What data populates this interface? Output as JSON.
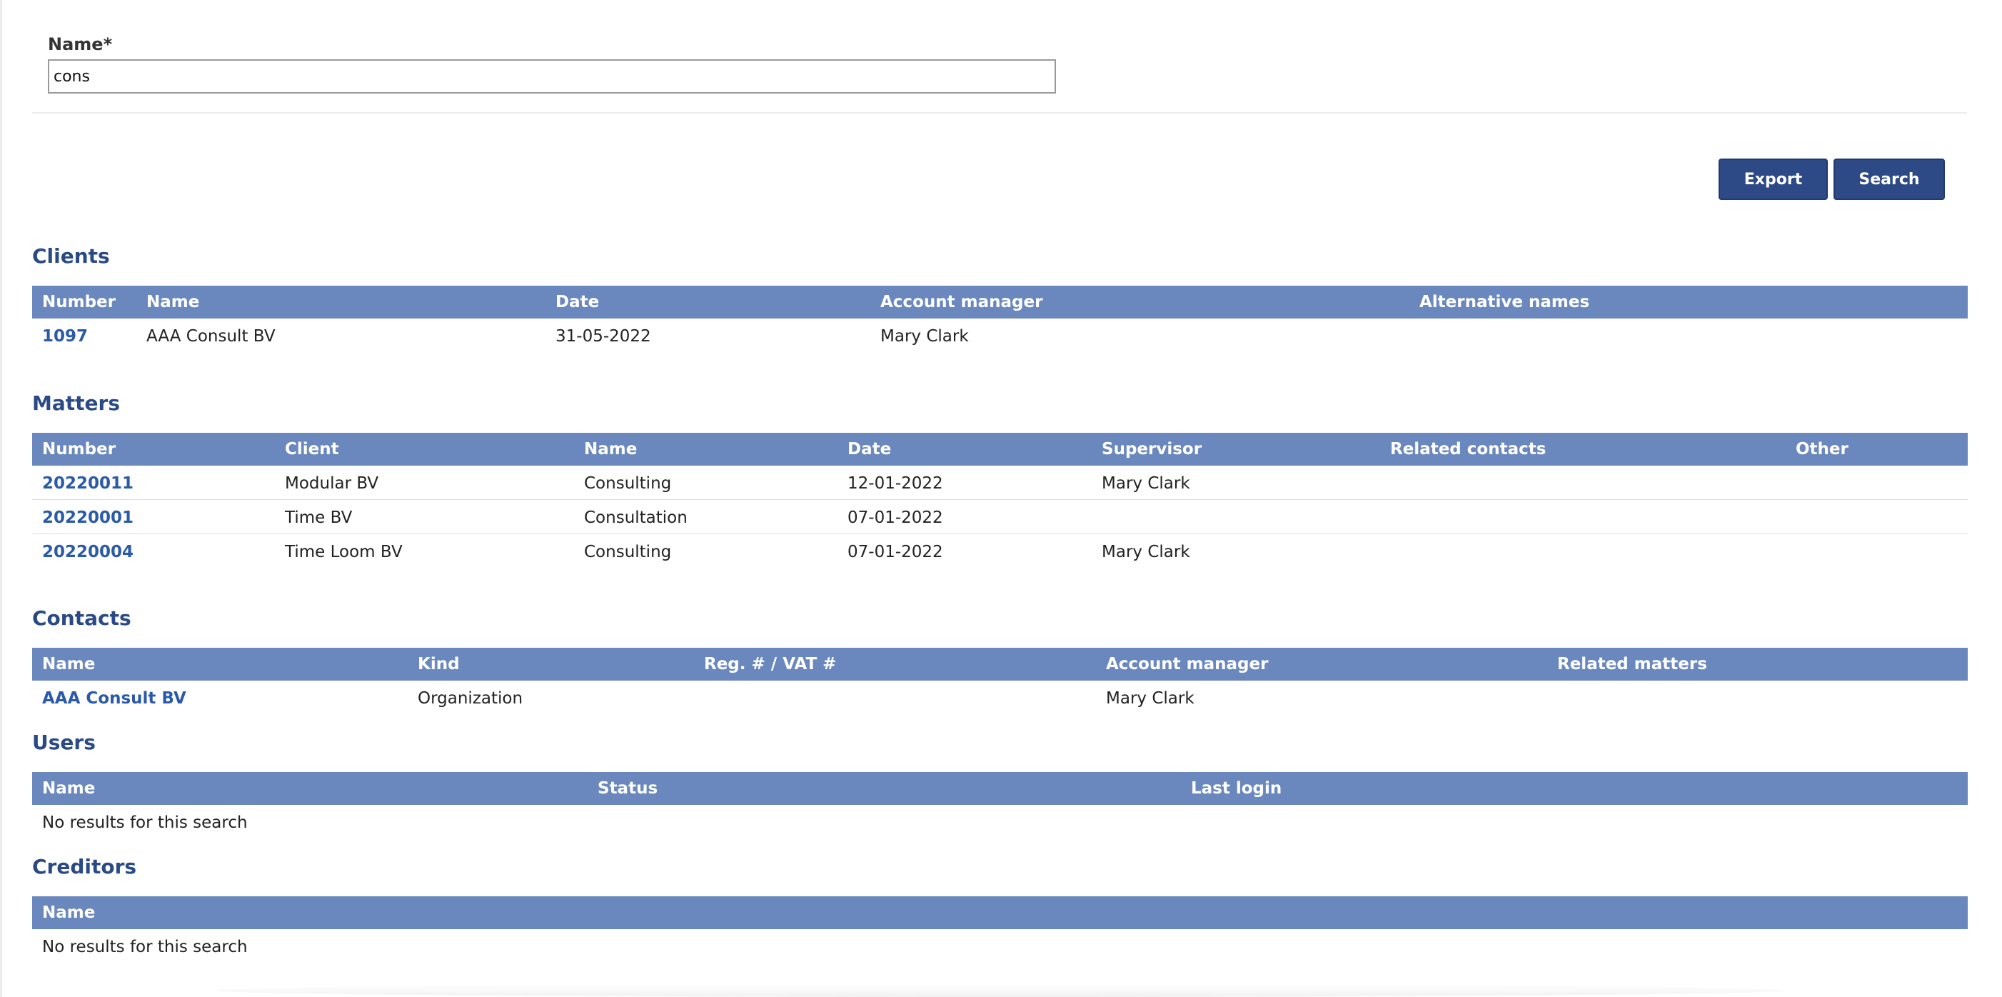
{
  "form": {
    "name_label": "Name*",
    "name_value": "cons"
  },
  "actions": {
    "export_label": "Export",
    "search_label": "Search"
  },
  "clients": {
    "title": "Clients",
    "columns": [
      "Number",
      "Name",
      "Date",
      "Account manager",
      "Alternative names"
    ],
    "rows": [
      {
        "number": "1097",
        "name": "AAA Consult BV",
        "date": "31-05-2022",
        "account_manager": "Mary Clark",
        "alternative_names": ""
      }
    ]
  },
  "matters": {
    "title": "Matters",
    "columns": [
      "Number",
      "Client",
      "Name",
      "Date",
      "Supervisor",
      "Related contacts",
      "Other"
    ],
    "rows": [
      {
        "number": "20220011",
        "client": "Modular BV",
        "name": "Consulting",
        "date": "12-01-2022",
        "supervisor": "Mary Clark",
        "related_contacts": "",
        "other": ""
      },
      {
        "number": "20220001",
        "client": "Time BV",
        "name": "Consultation",
        "date": "07-01-2022",
        "supervisor": "",
        "related_contacts": "",
        "other": ""
      },
      {
        "number": "20220004",
        "client": "Time Loom BV",
        "name": "Consulting",
        "date": "07-01-2022",
        "supervisor": "Mary Clark",
        "related_contacts": "",
        "other": ""
      }
    ]
  },
  "contacts": {
    "title": "Contacts",
    "columns": [
      "Name",
      "Kind",
      "Reg. # / VAT #",
      "Account manager",
      "Related matters"
    ],
    "rows": [
      {
        "name": "AAA Consult BV",
        "kind": "Organization",
        "reg_vat": "",
        "account_manager": "Mary Clark",
        "related_matters": ""
      }
    ]
  },
  "users": {
    "title": "Users",
    "columns": [
      "Name",
      "Status",
      "Last login"
    ],
    "empty_text": "No results for this search"
  },
  "creditors": {
    "title": "Creditors",
    "columns": [
      "Name"
    ],
    "empty_text": "No results for this search"
  }
}
